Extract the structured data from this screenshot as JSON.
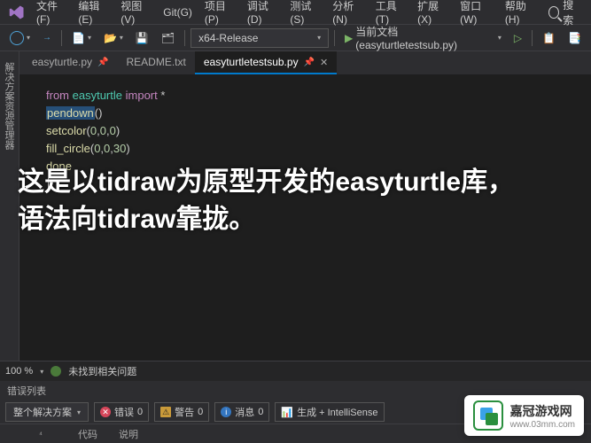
{
  "menubar": {
    "items": [
      "文件(F)",
      "编辑(E)",
      "视图(V)",
      "Git(G)",
      "项目(P)",
      "调试(D)",
      "测试(S)",
      "分析(N)",
      "工具(T)",
      "扩展(X)",
      "窗口(W)",
      "帮助(H)"
    ],
    "search_label": "搜索"
  },
  "toolbar": {
    "config": "x64-Release",
    "debug_target": "当前文档(easyturtletestsub.py)"
  },
  "sidebar": {
    "tab_label": "解决方案资源管理器"
  },
  "tabs": [
    {
      "label": "easyturtle.py",
      "pinned": true,
      "active": false
    },
    {
      "label": "README.txt",
      "pinned": false,
      "active": false
    },
    {
      "label": "easyturtletestsub.py",
      "pinned": true,
      "active": true
    }
  ],
  "code": {
    "l1": {
      "kw1": "from",
      "mod": "easyturtle",
      "kw2": "import",
      "star": "*"
    },
    "l2": {
      "fn": "pendown",
      "args": "()"
    },
    "l3": {
      "fn": "setcolor",
      "args": "(",
      "n1": "0",
      "c": ",",
      "n2": "0",
      "n3": "0",
      "end": ")"
    },
    "l4": {
      "fn": "fill_circle",
      "args": "(",
      "n1": "0",
      "n2": "0",
      "n3": "30",
      "c": ",",
      "end": ")"
    },
    "l5": {
      "txt": "done"
    }
  },
  "overlay": {
    "line1": "这是以tidraw为原型开发的easyturtle库，",
    "line2": "语法向tidraw靠拢。"
  },
  "status": {
    "zoom": "100 %",
    "msg": "未找到相关问题"
  },
  "errors": {
    "title": "错误列表",
    "scope": "整个解决方案",
    "err_label": "错误",
    "err_count": "0",
    "warn_label": "警告",
    "warn_count": "0",
    "info_label": "消息",
    "info_count": "0",
    "build_label": "生成 + IntelliSense",
    "cols": [
      "",
      "代码",
      "说明"
    ]
  },
  "watermark": {
    "name": "嘉冠游戏网",
    "url": "www.03mm.com"
  }
}
